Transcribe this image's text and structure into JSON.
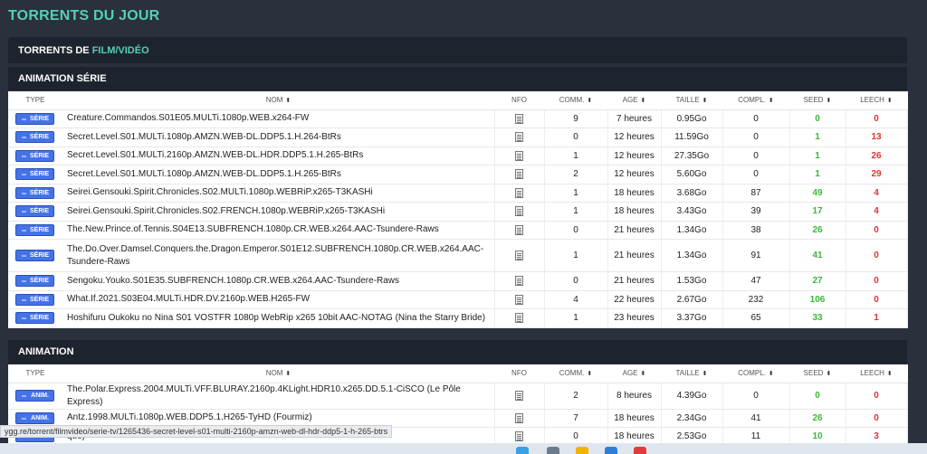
{
  "page_title": "TORRENTS DU JOUR",
  "torrents_header": {
    "prefix": "TORRENTS DE",
    "category": "FILM/VIDÉO"
  },
  "columns": {
    "type": "TYPE",
    "name": "NOM",
    "nfo": "NFO",
    "comm": "COMM.",
    "age": "AGE",
    "size": "TAILLE",
    "compl": "COMPL.",
    "seed": "SEED",
    "leech": "LEECH"
  },
  "sections": [
    {
      "title": "ANIMATION SÉRIE",
      "rows": [
        {
          "type": "SÉRIE",
          "name": "Creature.Commandos.S01E05.MULTi.1080p.WEB.x264-FW",
          "comm": "9",
          "age": "7 heures",
          "size": "0.95Go",
          "compl": "0",
          "seed": "0",
          "leech": "0"
        },
        {
          "type": "SÉRIE",
          "name": "Secret.Level.S01.MULTi.1080p.AMZN.WEB-DL.DDP5.1.H.264-BtRs",
          "comm": "0",
          "age": "12 heures",
          "size": "11.59Go",
          "compl": "0",
          "seed": "1",
          "leech": "13"
        },
        {
          "type": "SÉRIE",
          "name": "Secret.Level.S01.MULTi.2160p.AMZN.WEB-DL.HDR.DDP5.1.H.265-BtRs",
          "comm": "1",
          "age": "12 heures",
          "size": "27.35Go",
          "compl": "0",
          "seed": "1",
          "leech": "26"
        },
        {
          "type": "SÉRIE",
          "name": "Secret.Level.S01.MULTi.1080p.AMZN.WEB-DL.DDP5.1.H.265-BtRs",
          "comm": "2",
          "age": "12 heures",
          "size": "5.60Go",
          "compl": "0",
          "seed": "1",
          "leech": "29"
        },
        {
          "type": "SÉRIE",
          "name": "Seirei.Gensouki.Spirit.Chronicles.S02.MULTi.1080p.WEBRiP.x265-T3KASHi",
          "comm": "1",
          "age": "18 heures",
          "size": "3.68Go",
          "compl": "87",
          "seed": "49",
          "leech": "4"
        },
        {
          "type": "SÉRIE",
          "name": "Seirei.Gensouki.Spirit.Chronicles.S02.FRENCH.1080p.WEBRiP.x265-T3KASHi",
          "comm": "1",
          "age": "18 heures",
          "size": "3.43Go",
          "compl": "39",
          "seed": "17",
          "leech": "4"
        },
        {
          "type": "SÉRIE",
          "name": "The.New.Prince.of.Tennis.S04E13.SUBFRENCH.1080p.CR.WEB.x264.AAC-Tsundere-Raws",
          "comm": "0",
          "age": "21 heures",
          "size": "1.34Go",
          "compl": "38",
          "seed": "26",
          "leech": "0"
        },
        {
          "type": "SÉRIE",
          "name": "The.Do.Over.Damsel.Conquers.the.Dragon.Emperor.S01E12.SUBFRENCH.1080p.CR.WEB.x264.AAC-Tsundere-Raws",
          "comm": "1",
          "age": "21 heures",
          "size": "1.34Go",
          "compl": "91",
          "seed": "41",
          "leech": "0",
          "tall": true
        },
        {
          "type": "SÉRIE",
          "name": "Sengoku.Youko.S01E35.SUBFRENCH.1080p.CR.WEB.x264.AAC-Tsundere-Raws",
          "comm": "0",
          "age": "21 heures",
          "size": "1.53Go",
          "compl": "47",
          "seed": "27",
          "leech": "0"
        },
        {
          "type": "SÉRIE",
          "name": "What.If.2021.S03E04.MULTi.HDR.DV.2160p.WEB.H265-FW",
          "comm": "4",
          "age": "22 heures",
          "size": "2.67Go",
          "compl": "232",
          "seed": "106",
          "leech": "0"
        },
        {
          "type": "SÉRIE",
          "name": "Hoshifuru Oukoku no Nina S01 VOSTFR 1080p WebRip x265 10bit AAC-NOTAG (Nina the Starry Bride)",
          "comm": "1",
          "age": "23 heures",
          "size": "3.37Go",
          "compl": "65",
          "seed": "33",
          "leech": "1"
        }
      ]
    },
    {
      "title": "ANIMATION",
      "rows": [
        {
          "type": "ANIM.",
          "name": "The.Polar.Express.2004.MULTi.VFF.BLURAY.2160p.4KLight.HDR10.x265.DD.5.1-CiSCO (Le Pôle Express)",
          "comm": "2",
          "age": "8 heures",
          "size": "4.39Go",
          "compl": "0",
          "seed": "0",
          "leech": "0"
        },
        {
          "type": "ANIM.",
          "name": "Antz.1998.MULTi.1080p.WEB.DDP5.1.H265-TyHD (Fourmiz)",
          "comm": "7",
          "age": "18 heures",
          "size": "2.34Go",
          "compl": "41",
          "seed": "26",
          "leech": "0"
        },
        {
          "type": "ANIM.",
          "name": "que)",
          "comm": "0",
          "age": "18 heures",
          "size": "2.53Go",
          "compl": "11",
          "seed": "10",
          "leech": "3"
        }
      ]
    }
  ],
  "status_url": "ygg.re/torrent/filmvideo/serie-tv/1265436-secret-level-s01-multi-2160p-amzn-web-dl-hdr-ddp5-1-h-265-btrs",
  "colors": {
    "accent": "#52d1b8",
    "badge": "#4472e9",
    "seed": "#3bb83b",
    "leech": "#e83030"
  }
}
